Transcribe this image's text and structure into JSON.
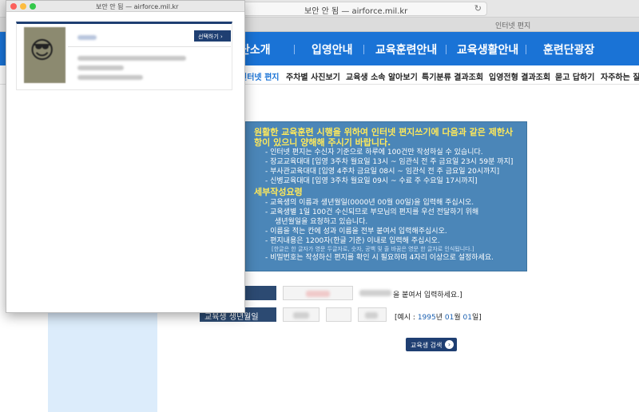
{
  "background_window": {
    "title": "보안 안 됨 — airforce.mil.kr",
    "url": "보안 안 됨 — airforce.mil.kr",
    "tab_label": "인터넷 편지",
    "main_nav": [
      "단소개",
      "입영안내",
      "교육훈련안내",
      "교육생활안내",
      "훈련단광장"
    ],
    "sub_nav": [
      "인터넷 편지",
      "주차별 사진보기",
      "교육생 소속 알아보기",
      "특기분류 결과조회",
      "입영전형 결과조회",
      "묻고 답하기",
      "자주하는 질"
    ],
    "notice": {
      "heading": "원활한 교육훈련 시행을 위하여 인터넷 편지쓰기에 다음과 같은 제한사항이 있으니 양해해 주시기 바랍니다.",
      "lines": [
        "- 인터넷 편지는 수신자 기준으로 하루에 100건만 작성하실 수 있습니다.",
        "- 장교교육대대 [입영 3주차 월요일 13시 ~ 임관식 전 주 금요일 23시 59분 까지]",
        "- 부사관교육대대 [입영 4주차 금요일 08시 ~ 임관식 전 주 금요일 20시까지]",
        "- 신병교육대대 [입영 3주차 월요일 09시 ~ 수료 주 수요일 17시까지]"
      ],
      "sub_heading": "세부작성요령",
      "details": [
        "- 교육생의 이름과 생년월일(0000년 00월 00일)을 입력해 주십시오.",
        "- 교육생별 1일 100건 수신되므로 부모님의 편지를 우선 전달하기 위해",
        "생년월일을 요청하고 있습니다.",
        "- 이름을 적는 칸에 성과 이름을 전부 붙여서 입력해주십시오.",
        "- 편지내용은 1200자(한글 기준) 이내로 입력해 주십시오."
      ],
      "small_note": "[한글은 한 글자가 영문 두글자로, 숫자, 공백 및 줄 바꿈은 영문 한 글자로 인식됩니다.]",
      "last_line": "- 비밀번호는 작성하신 편지를 확인 시 필요하며 4자리 이상으로 설정하세요."
    },
    "form": {
      "birth_label": "교육생 생년월일",
      "name_note": "을 붙여서 입력하세요.]",
      "example_prefix": "[예시 : ",
      "example_year": "1995",
      "example_year_unit": "년 ",
      "example_month": "01",
      "example_month_unit": "월 ",
      "example_day": "01",
      "example_day_unit": "일]",
      "search_button": "교육생 검색"
    }
  },
  "popup_window": {
    "title": "보안 안 됨 — airforce.mil.kr",
    "select_button": "선택하기 ›",
    "avatar_emoji": "😎"
  },
  "colors": {
    "nav_blue": "#1a73d6",
    "notice_bg": "#4b86b8",
    "notice_heading": "#ffe95a",
    "dark_navy": "#1f3f72"
  }
}
